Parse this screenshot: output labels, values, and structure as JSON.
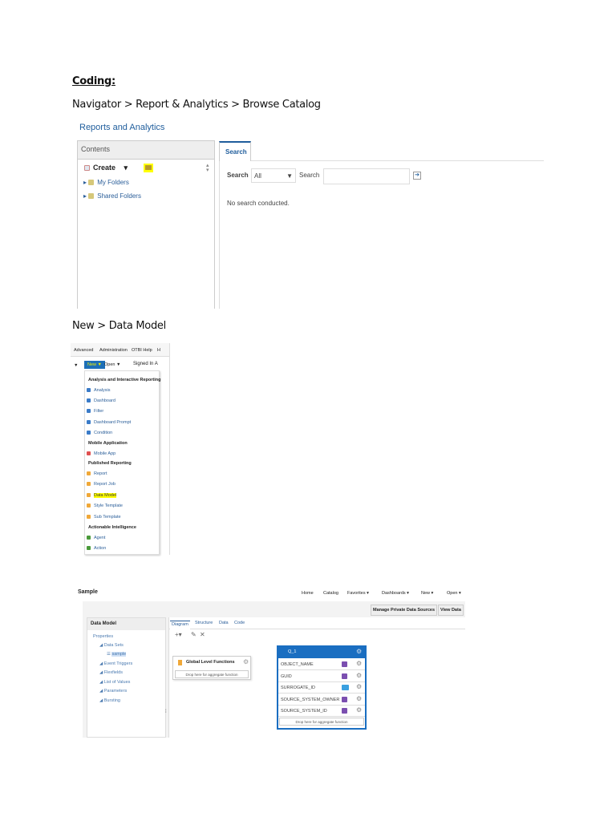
{
  "doc": {
    "heading": "Coding:",
    "step1": "Navigator > Report & Analytics > Browse Catalog",
    "step2": "New > Data Model"
  },
  "catalog": {
    "title": "Reports and Analytics",
    "contents_header": "Contents",
    "create_label": "Create",
    "folders": [
      "My Folders",
      "Shared Folders"
    ],
    "search_tab": "Search",
    "search_label": "Search",
    "search_scope": "All",
    "search_label2": "Search",
    "search_value": "",
    "no_results": "No search conducted."
  },
  "newmenu": {
    "topnav": [
      "Advanced",
      "Administration",
      "OTBI Help",
      "H"
    ],
    "new_label": "New ▼",
    "open_label": "Open ▼",
    "signed_in": "Signed In A",
    "groups": [
      {
        "header": "Analysis and Interactive Reporting",
        "items": [
          "Analysis",
          "Dashboard",
          "Filter",
          "Dashboard Prompt",
          "Condition"
        ]
      },
      {
        "header": "Mobile Application",
        "items": [
          "Mobile App"
        ]
      },
      {
        "header": "Published Reporting",
        "items": [
          "Report",
          "Report Job",
          "Data Model",
          "Style Template",
          "Sub Template"
        ]
      },
      {
        "header": "Actionable Intelligence",
        "items": [
          "Agent",
          "Action"
        ]
      }
    ],
    "highlighted": "Data Model"
  },
  "datamodel": {
    "title": "Sample",
    "nav": [
      "Home",
      "Catalog",
      "Favorites ▾",
      "Dashboards ▾",
      "New ▾",
      "Open ▾"
    ],
    "buttons": [
      "Manage Private Data Sources",
      "View Data"
    ],
    "panel_title": "Data Model",
    "tree": [
      "Properties",
      "Data Sets",
      "sample",
      "Event Triggers",
      "Flexfields",
      "List of Values",
      "Parameters",
      "Bursting"
    ],
    "tabs": [
      "Diagram",
      "Structure",
      "Data",
      "Code"
    ],
    "toolbar": [
      "+▾",
      "✎",
      "✕"
    ],
    "global_box": {
      "title": "Global Level Functions",
      "drop": "Drop here for aggregate function"
    },
    "query": {
      "name": "Q_1",
      "columns": [
        "OBJECT_NAME",
        "GUID",
        "SURROGATE_ID",
        "SOURCE_SYSTEM_OWNER",
        "SOURCE_SYSTEM_ID"
      ],
      "drop": "Drop here for aggregate function"
    }
  }
}
